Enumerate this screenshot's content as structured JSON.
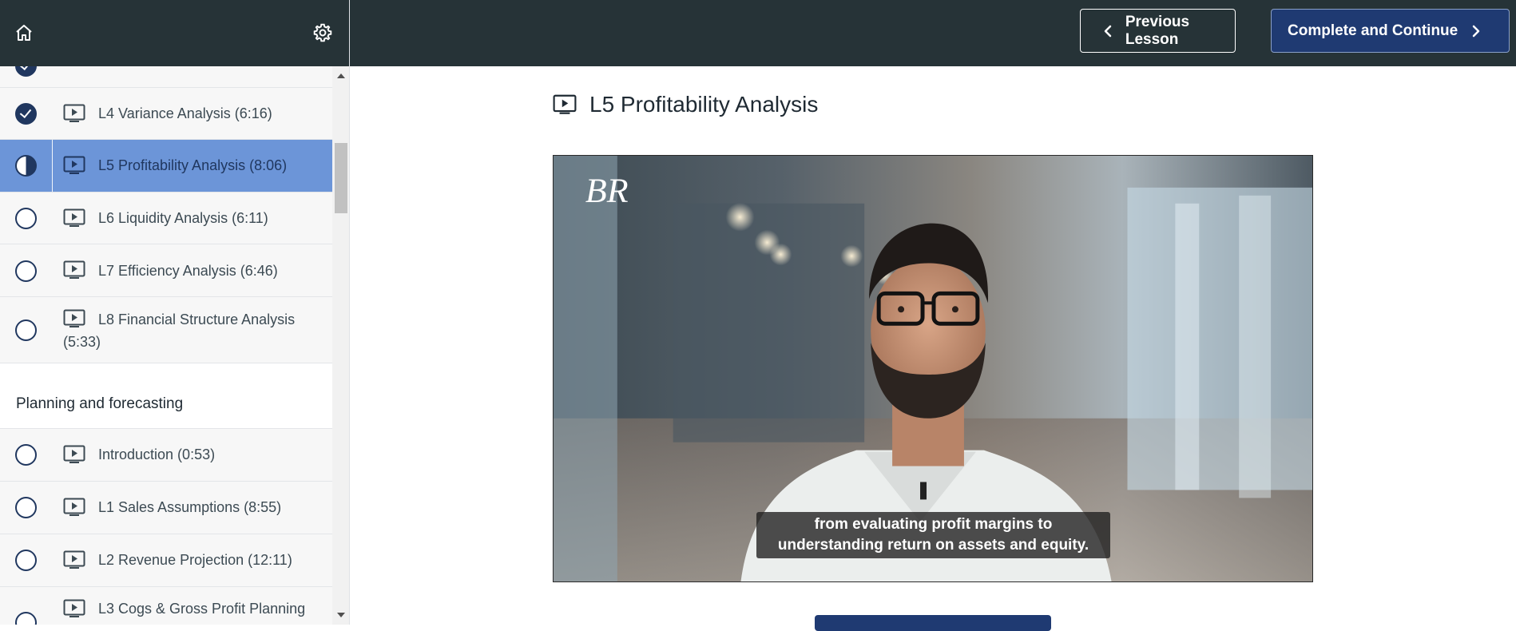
{
  "sidebar": {
    "header": {
      "home_icon": "home-icon",
      "settings_icon": "gear-icon"
    },
    "lessons_top": [
      {
        "title": "L4 Variance Analysis (6:16)",
        "status": "complete"
      },
      {
        "title": "L5 Profitability Analysis (8:06)",
        "status": "in-progress",
        "active": true
      },
      {
        "title": "L6 Liquidity Analysis (6:11)",
        "status": "not-started"
      },
      {
        "title": "L7 Efficiency Analysis (6:46)",
        "status": "not-started"
      },
      {
        "title": "L8 Financial Structure Analysis (5:33)",
        "status": "not-started"
      }
    ],
    "section": {
      "title": "Planning and forecasting"
    },
    "lessons_bottom": [
      {
        "title": "Introduction (0:53)",
        "status": "not-started"
      },
      {
        "title": "L1 Sales Assumptions (8:55)",
        "status": "not-started"
      },
      {
        "title": "L2 Revenue Projection (12:11)",
        "status": "not-started"
      },
      {
        "title": "L3 Cogs & Gross Profit Planning",
        "status": "not-started"
      }
    ]
  },
  "topbar": {
    "previous_label": "Previous Lesson",
    "next_label": "Complete and Continue"
  },
  "main": {
    "lesson_title": "L5 Profitability Analysis",
    "video": {
      "logo_text": "BR",
      "caption_line1": "from evaluating profit margins to",
      "caption_line2": "understanding return on assets and equity."
    }
  },
  "colors": {
    "header_bg": "#263337",
    "active_item": "#6c95d8",
    "accent": "#1f3a72",
    "status_ring": "#20375f"
  }
}
